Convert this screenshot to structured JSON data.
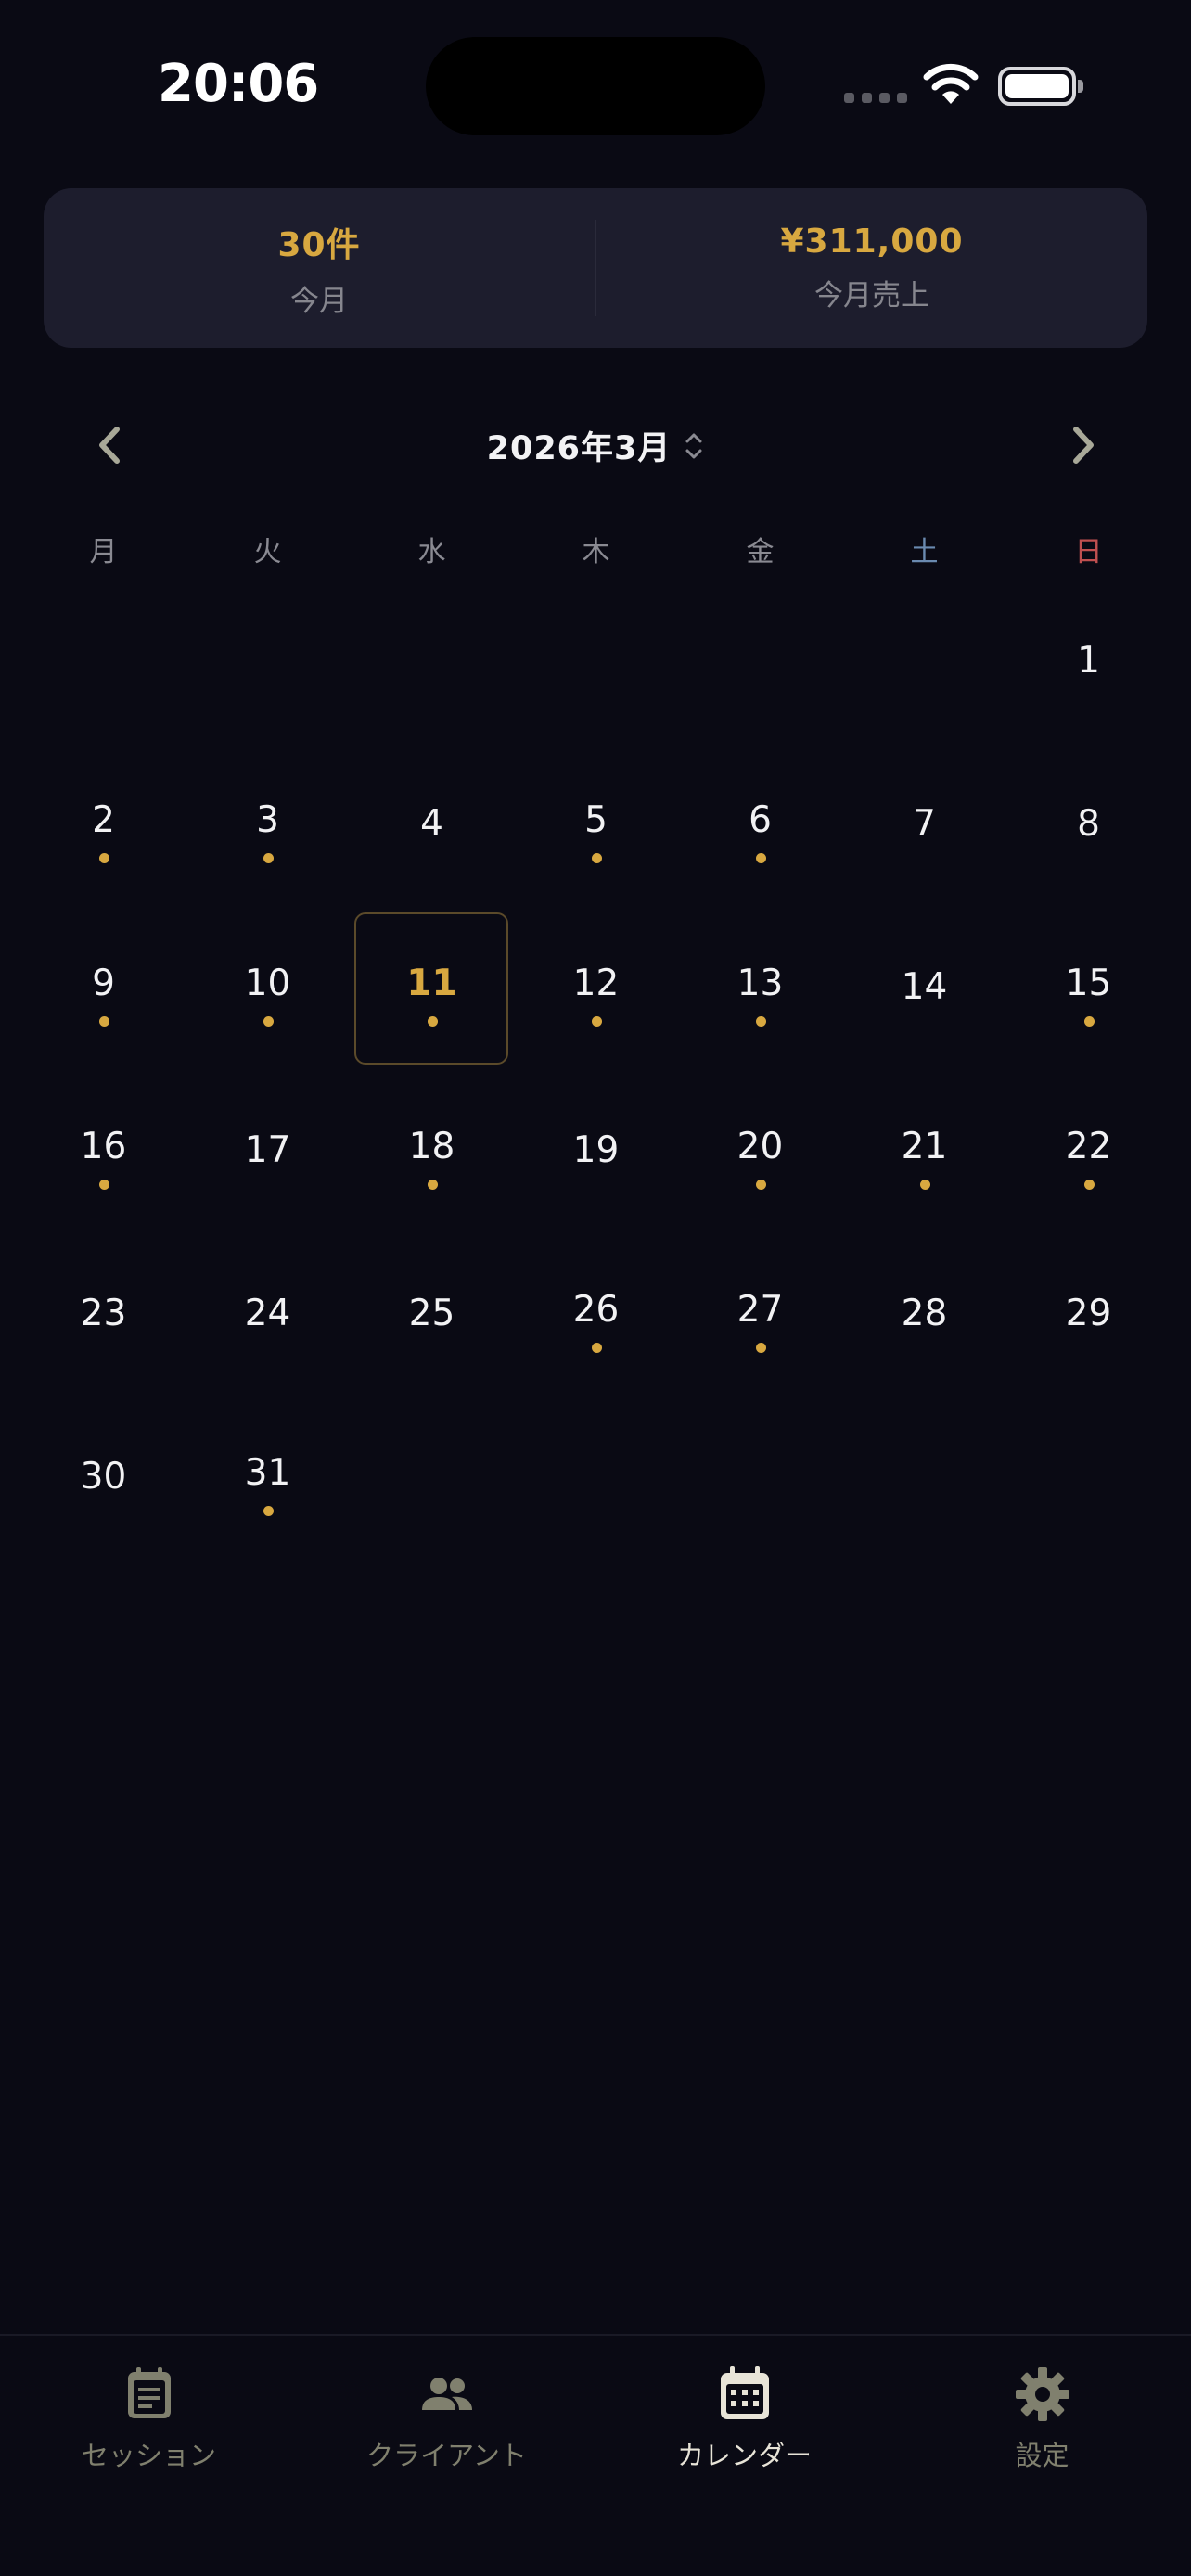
{
  "status": {
    "time": "20:06"
  },
  "summary": {
    "count_value": "30件",
    "count_label": "今月",
    "sales_value": "¥311,000",
    "sales_label": "今月売上"
  },
  "calendar": {
    "month_title": "2026年3月",
    "weekdays": [
      "月",
      "火",
      "水",
      "木",
      "金",
      "土",
      "日"
    ],
    "days": [
      {
        "n": "",
        "dot": false
      },
      {
        "n": "",
        "dot": false
      },
      {
        "n": "",
        "dot": false
      },
      {
        "n": "",
        "dot": false
      },
      {
        "n": "",
        "dot": false
      },
      {
        "n": "",
        "dot": false
      },
      {
        "n": "1",
        "dot": false
      },
      {
        "n": "2",
        "dot": true
      },
      {
        "n": "3",
        "dot": true
      },
      {
        "n": "4",
        "dot": false
      },
      {
        "n": "5",
        "dot": true
      },
      {
        "n": "6",
        "dot": true
      },
      {
        "n": "7",
        "dot": false
      },
      {
        "n": "8",
        "dot": false
      },
      {
        "n": "9",
        "dot": true
      },
      {
        "n": "10",
        "dot": true
      },
      {
        "n": "11",
        "dot": true,
        "today": true
      },
      {
        "n": "12",
        "dot": true
      },
      {
        "n": "13",
        "dot": true
      },
      {
        "n": "14",
        "dot": false
      },
      {
        "n": "15",
        "dot": true
      },
      {
        "n": "16",
        "dot": true
      },
      {
        "n": "17",
        "dot": false
      },
      {
        "n": "18",
        "dot": true
      },
      {
        "n": "19",
        "dot": false
      },
      {
        "n": "20",
        "dot": true
      },
      {
        "n": "21",
        "dot": true
      },
      {
        "n": "22",
        "dot": true
      },
      {
        "n": "23",
        "dot": false
      },
      {
        "n": "24",
        "dot": false
      },
      {
        "n": "25",
        "dot": false
      },
      {
        "n": "26",
        "dot": true
      },
      {
        "n": "27",
        "dot": true
      },
      {
        "n": "28",
        "dot": false
      },
      {
        "n": "29",
        "dot": false
      },
      {
        "n": "30",
        "dot": false
      },
      {
        "n": "31",
        "dot": true
      }
    ]
  },
  "tabs": [
    {
      "label": "セッション",
      "icon": "session-note-icon",
      "active": false
    },
    {
      "label": "クライアント",
      "icon": "people-icon",
      "active": false
    },
    {
      "label": "カレンダー",
      "icon": "calendar-icon",
      "active": true
    },
    {
      "label": "設定",
      "icon": "gear-icon",
      "active": false
    }
  ],
  "colors": {
    "accent": "#d8a840",
    "background": "#0a0a14",
    "card": "#1d1d2d",
    "saturday": "#6a8ab0",
    "sunday": "#c05050"
  }
}
